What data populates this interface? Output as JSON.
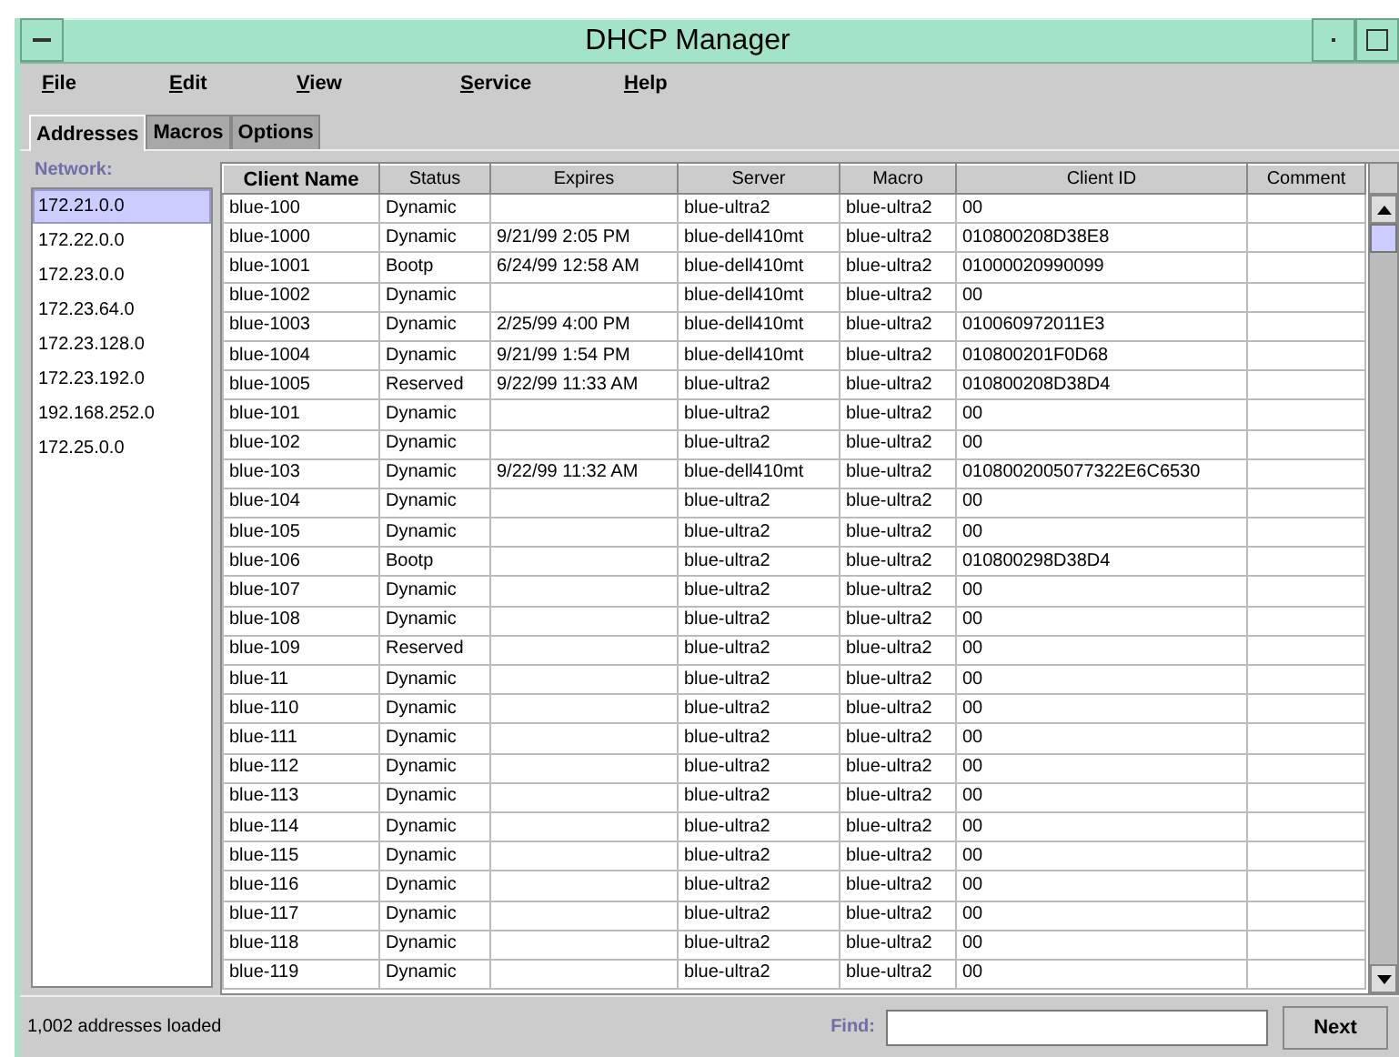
{
  "window": {
    "title": "DHCP Manager"
  },
  "menu": [
    "File",
    "Edit",
    "View",
    "Service",
    "Help"
  ],
  "tabs": [
    {
      "label": "Addresses",
      "selected": true
    },
    {
      "label": "Macros",
      "selected": false
    },
    {
      "label": "Options",
      "selected": false
    }
  ],
  "network": {
    "label": "Network:",
    "items": [
      {
        "label": "172.21.0.0",
        "selected": true
      },
      {
        "label": "172.22.0.0",
        "selected": false
      },
      {
        "label": "172.23.0.0",
        "selected": false
      },
      {
        "label": "172.23.64.0",
        "selected": false
      },
      {
        "label": "172.23.128.0",
        "selected": false
      },
      {
        "label": "172.23.192.0",
        "selected": false
      },
      {
        "label": "192.168.252.0",
        "selected": false
      },
      {
        "label": "172.25.0.0",
        "selected": false
      }
    ]
  },
  "table": {
    "columns": [
      {
        "label": "Client Name",
        "sorted": true
      },
      {
        "label": "Status",
        "sorted": false
      },
      {
        "label": "Expires",
        "sorted": false
      },
      {
        "label": "Server",
        "sorted": false
      },
      {
        "label": "Macro",
        "sorted": false
      },
      {
        "label": "Client ID",
        "sorted": false
      },
      {
        "label": "Comment",
        "sorted": false
      }
    ],
    "rows": [
      {
        "client_name": "blue-100",
        "status": "Dynamic",
        "server": "blue-ultra2",
        "macro": "blue-ultra2",
        "client_id": "00"
      },
      {
        "client_name": "blue-1000",
        "status": "Dynamic",
        "expires": "9/21/99 2:05 PM",
        "server": "blue-dell410mt",
        "macro": "blue-ultra2",
        "client_id": "010800208D38E8"
      },
      {
        "client_name": "blue-1001",
        "status": "Bootp",
        "expires": "6/24/99 12:58 AM",
        "server": "blue-dell410mt",
        "macro": "blue-ultra2",
        "client_id": "01000020990099"
      },
      {
        "client_name": "blue-1002",
        "status": "Dynamic",
        "server": "blue-dell410mt",
        "macro": "blue-ultra2",
        "client_id": "00"
      },
      {
        "client_name": "blue-1003",
        "status": "Dynamic",
        "expires": "2/25/99 4:00 PM",
        "server": "blue-dell410mt",
        "macro": "blue-ultra2",
        "client_id": "010060972011E3"
      },
      {
        "client_name": "blue-1004",
        "status": "Dynamic",
        "expires": "9/21/99 1:54 PM",
        "server": "blue-dell410mt",
        "macro": "blue-ultra2",
        "client_id": "010800201F0D68"
      },
      {
        "client_name": "blue-1005",
        "status": "Reserved",
        "expires": "9/22/99 11:33 AM",
        "server": "blue-ultra2",
        "macro": "blue-ultra2",
        "client_id": "010800208D38D4"
      },
      {
        "client_name": "blue-101",
        "status": "Dynamic",
        "server": "blue-ultra2",
        "macro": "blue-ultra2",
        "client_id": "00"
      },
      {
        "client_name": "blue-102",
        "status": "Dynamic",
        "server": "blue-ultra2",
        "macro": "blue-ultra2",
        "client_id": "00"
      },
      {
        "client_name": "blue-103",
        "status": "Dynamic",
        "expires": "9/22/99 11:32 AM",
        "server": "blue-dell410mt",
        "macro": "blue-ultra2",
        "client_id": "0108002005077322E6C6530"
      },
      {
        "client_name": "blue-104",
        "status": "Dynamic",
        "server": "blue-ultra2",
        "macro": "blue-ultra2",
        "client_id": "00"
      },
      {
        "client_name": "blue-105",
        "status": "Dynamic",
        "server": "blue-ultra2",
        "macro": "blue-ultra2",
        "client_id": "00"
      },
      {
        "client_name": "blue-106",
        "status": "Bootp",
        "server": "blue-ultra2",
        "macro": "blue-ultra2",
        "client_id": "010800298D38D4"
      },
      {
        "client_name": "blue-107",
        "status": "Dynamic",
        "server": "blue-ultra2",
        "macro": "blue-ultra2",
        "client_id": "00"
      },
      {
        "client_name": "blue-108",
        "status": "Dynamic",
        "server": "blue-ultra2",
        "macro": "blue-ultra2",
        "client_id": "00"
      },
      {
        "client_name": "blue-109",
        "status": "Reserved",
        "server": "blue-ultra2",
        "macro": "blue-ultra2",
        "client_id": "00"
      },
      {
        "client_name": "blue-11",
        "status": "Dynamic",
        "server": "blue-ultra2",
        "macro": "blue-ultra2",
        "client_id": "00"
      },
      {
        "client_name": "blue-110",
        "status": "Dynamic",
        "server": "blue-ultra2",
        "macro": "blue-ultra2",
        "client_id": "00"
      },
      {
        "client_name": "blue-111",
        "status": "Dynamic",
        "server": "blue-ultra2",
        "macro": "blue-ultra2",
        "client_id": "00"
      },
      {
        "client_name": "blue-112",
        "status": "Dynamic",
        "server": "blue-ultra2",
        "macro": "blue-ultra2",
        "client_id": "00"
      },
      {
        "client_name": "blue-113",
        "status": "Dynamic",
        "server": "blue-ultra2",
        "macro": "blue-ultra2",
        "client_id": "00"
      },
      {
        "client_name": "blue-114",
        "status": "Dynamic",
        "server": "blue-ultra2",
        "macro": "blue-ultra2",
        "client_id": "00"
      },
      {
        "client_name": "blue-115",
        "status": "Dynamic",
        "server": "blue-ultra2",
        "macro": "blue-ultra2",
        "client_id": "00"
      },
      {
        "client_name": "blue-116",
        "status": "Dynamic",
        "server": "blue-ultra2",
        "macro": "blue-ultra2",
        "client_id": "00"
      },
      {
        "client_name": "blue-117",
        "status": "Dynamic",
        "server": "blue-ultra2",
        "macro": "blue-ultra2",
        "client_id": "00"
      },
      {
        "client_name": "blue-118",
        "status": "Dynamic",
        "server": "blue-ultra2",
        "macro": "blue-ultra2",
        "client_id": "00"
      },
      {
        "client_name": "blue-119",
        "status": "Dynamic",
        "server": "blue-ultra2",
        "macro": "blue-ultra2",
        "client_id": "00"
      }
    ]
  },
  "status_bar": {
    "message": "1,002 addresses loaded",
    "find_label": "Find:",
    "next_button": "Next"
  }
}
